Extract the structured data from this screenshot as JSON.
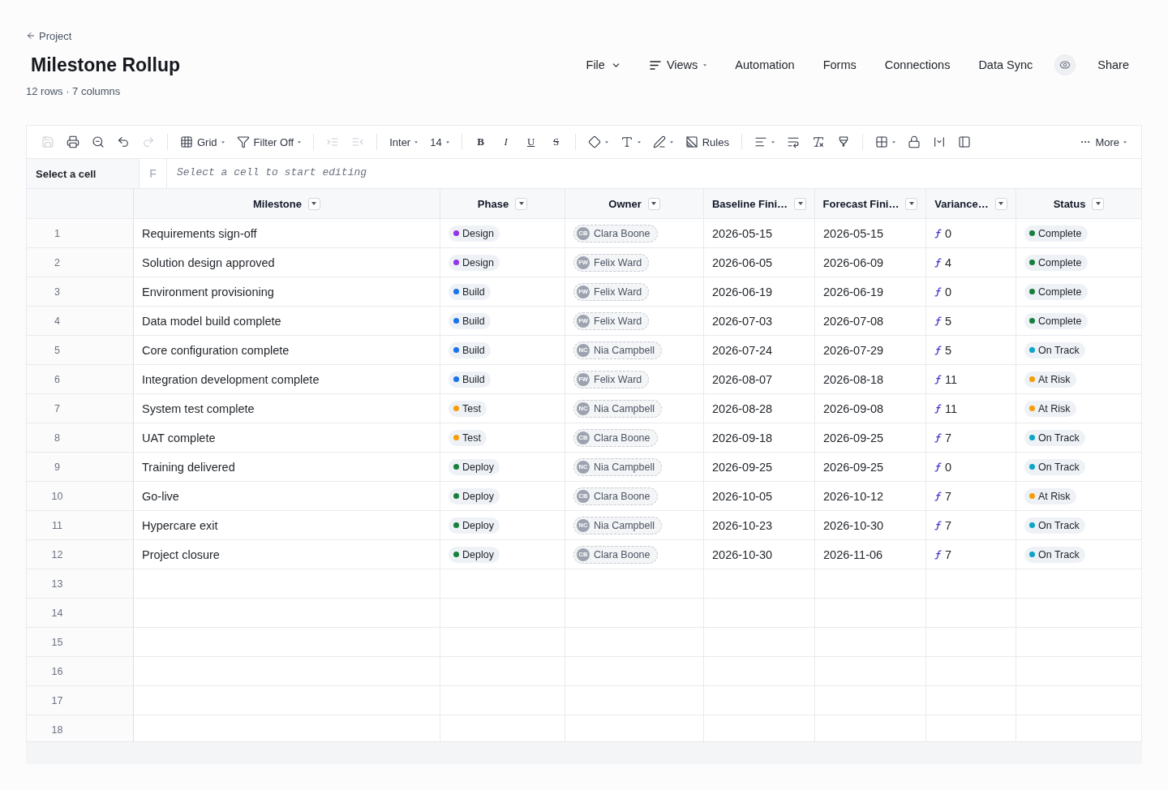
{
  "header": {
    "back_link": "Project",
    "title": "Milestone Rollup",
    "summary": "12 rows · 7 columns"
  },
  "nav": [
    {
      "kind": "menu",
      "label": "File"
    },
    {
      "kind": "views",
      "label": "Views"
    },
    {
      "kind": "link",
      "label": "Automation"
    },
    {
      "kind": "link",
      "label": "Forms"
    },
    {
      "kind": "link",
      "label": "Connections"
    },
    {
      "kind": "link",
      "label": "Data Sync"
    },
    {
      "kind": "eye"
    },
    {
      "kind": "link",
      "label": "Share"
    }
  ],
  "toolbar": {
    "groups": [
      [
        {
          "kind": "icon",
          "disabled": true
        },
        {
          "kind": "icon",
          "disabled": false
        },
        {
          "kind": "icon",
          "disabled": false
        },
        {
          "kind": "icon",
          "disabled": false
        },
        {
          "kind": "icon",
          "disabled": true
        }
      ],
      [
        {
          "kind": "menu",
          "label": "Grid"
        },
        {
          "kind": "menu",
          "label": "Filter Off"
        }
      ],
      [
        {
          "kind": "icon",
          "disabled": true
        },
        {
          "kind": "icon",
          "disabled": true
        }
      ],
      [
        {
          "kind": "select",
          "label": "Inter"
        },
        {
          "kind": "select",
          "label": "14"
        }
      ],
      [
        {
          "kind": "format",
          "label": "B"
        },
        {
          "kind": "format",
          "label": "I"
        },
        {
          "kind": "format",
          "label": "U"
        },
        {
          "kind": "format",
          "label": "S"
        }
      ],
      [
        {
          "kind": "icon-menu",
          "disabled": false
        },
        {
          "kind": "icon-menu",
          "disabled": false
        },
        {
          "kind": "icon-menu",
          "disabled": false
        },
        {
          "kind": "labeled",
          "label": "Rules"
        }
      ],
      [
        {
          "kind": "icon-menu",
          "disabled": false
        },
        {
          "kind": "icon",
          "disabled": false
        },
        {
          "kind": "icon",
          "disabled": false
        },
        {
          "kind": "icon",
          "disabled": false
        }
      ],
      [
        {
          "kind": "icon-menu",
          "disabled": false
        },
        {
          "kind": "icon",
          "disabled": false
        },
        {
          "kind": "icon",
          "disabled": false
        },
        {
          "kind": "icon",
          "disabled": false
        }
      ]
    ],
    "more": {
      "label": "More"
    }
  },
  "formula_bar": {
    "cell_reference": "Select a cell",
    "fx_label": "F",
    "placeholder": "Select a cell to start editing"
  },
  "table": {
    "columns": [
      {
        "label": "Milestone"
      },
      {
        "label": "Phase"
      },
      {
        "label": "Owner"
      },
      {
        "label": "Baseline Fini…"
      },
      {
        "label": "Forecast Fini…"
      },
      {
        "label": "Variance…"
      },
      {
        "label": "Status"
      }
    ],
    "rows": [
      {
        "number": "1",
        "milestone": "Requirements sign-off",
        "phase": {
          "label": "Design",
          "color": "#9333ea"
        },
        "owner": {
          "initials": "CB",
          "name": "Clara Boone"
        },
        "baseline_finish": "2026-05-15",
        "forecast_finish": "2026-05-15",
        "variance": "0",
        "status": {
          "label": "Complete",
          "color": "#16803c"
        }
      },
      {
        "number": "2",
        "milestone": "Solution design approved",
        "phase": {
          "label": "Design",
          "color": "#9333ea"
        },
        "owner": {
          "initials": "FW",
          "name": "Felix Ward"
        },
        "baseline_finish": "2026-06-05",
        "forecast_finish": "2026-06-09",
        "variance": "4",
        "status": {
          "label": "Complete",
          "color": "#16803c"
        }
      },
      {
        "number": "3",
        "milestone": "Environment provisioning",
        "phase": {
          "label": "Build",
          "color": "#1a73e8"
        },
        "owner": {
          "initials": "FW",
          "name": "Felix Ward"
        },
        "baseline_finish": "2026-06-19",
        "forecast_finish": "2026-06-19",
        "variance": "0",
        "status": {
          "label": "Complete",
          "color": "#16803c"
        }
      },
      {
        "number": "4",
        "milestone": "Data model build complete",
        "phase": {
          "label": "Build",
          "color": "#1a73e8"
        },
        "owner": {
          "initials": "FW",
          "name": "Felix Ward"
        },
        "baseline_finish": "2026-07-03",
        "forecast_finish": "2026-07-08",
        "variance": "5",
        "status": {
          "label": "Complete",
          "color": "#16803c"
        }
      },
      {
        "number": "5",
        "milestone": "Core configuration complete",
        "phase": {
          "label": "Build",
          "color": "#1a73e8"
        },
        "owner": {
          "initials": "NC",
          "name": "Nia Campbell"
        },
        "baseline_finish": "2026-07-24",
        "forecast_finish": "2026-07-29",
        "variance": "5",
        "status": {
          "label": "On Track",
          "color": "#0ea5c6"
        }
      },
      {
        "number": "6",
        "milestone": "Integration development complete",
        "phase": {
          "label": "Build",
          "color": "#1a73e8"
        },
        "owner": {
          "initials": "FW",
          "name": "Felix Ward"
        },
        "baseline_finish": "2026-08-07",
        "forecast_finish": "2026-08-18",
        "variance": "11",
        "status": {
          "label": "At Risk",
          "color": "#f59e0b"
        }
      },
      {
        "number": "7",
        "milestone": "System test complete",
        "phase": {
          "label": "Test",
          "color": "#f59e0b"
        },
        "owner": {
          "initials": "NC",
          "name": "Nia Campbell"
        },
        "baseline_finish": "2026-08-28",
        "forecast_finish": "2026-09-08",
        "variance": "11",
        "status": {
          "label": "At Risk",
          "color": "#f59e0b"
        }
      },
      {
        "number": "8",
        "milestone": "UAT complete",
        "phase": {
          "label": "Test",
          "color": "#f59e0b"
        },
        "owner": {
          "initials": "CB",
          "name": "Clara Boone"
        },
        "baseline_finish": "2026-09-18",
        "forecast_finish": "2026-09-25",
        "variance": "7",
        "status": {
          "label": "On Track",
          "color": "#0ea5c6"
        }
      },
      {
        "number": "9",
        "milestone": "Training delivered",
        "phase": {
          "label": "Deploy",
          "color": "#16803c"
        },
        "owner": {
          "initials": "NC",
          "name": "Nia Campbell"
        },
        "baseline_finish": "2026-09-25",
        "forecast_finish": "2026-09-25",
        "variance": "0",
        "status": {
          "label": "On Track",
          "color": "#0ea5c6"
        }
      },
      {
        "number": "10",
        "milestone": "Go-live",
        "phase": {
          "label": "Deploy",
          "color": "#16803c"
        },
        "owner": {
          "initials": "CB",
          "name": "Clara Boone"
        },
        "baseline_finish": "2026-10-05",
        "forecast_finish": "2026-10-12",
        "variance": "7",
        "status": {
          "label": "At Risk",
          "color": "#f59e0b"
        }
      },
      {
        "number": "11",
        "milestone": "Hypercare exit",
        "phase": {
          "label": "Deploy",
          "color": "#16803c"
        },
        "owner": {
          "initials": "NC",
          "name": "Nia Campbell"
        },
        "baseline_finish": "2026-10-23",
        "forecast_finish": "2026-10-30",
        "variance": "7",
        "status": {
          "label": "On Track",
          "color": "#0ea5c6"
        }
      },
      {
        "number": "12",
        "milestone": "Project closure",
        "phase": {
          "label": "Deploy",
          "color": "#16803c"
        },
        "owner": {
          "initials": "CB",
          "name": "Clara Boone"
        },
        "baseline_finish": "2026-10-30",
        "forecast_finish": "2026-11-06",
        "variance": "7",
        "status": {
          "label": "On Track",
          "color": "#0ea5c6"
        }
      }
    ],
    "empty_rows": [
      "13",
      "14",
      "15",
      "16",
      "17",
      "18"
    ]
  }
}
